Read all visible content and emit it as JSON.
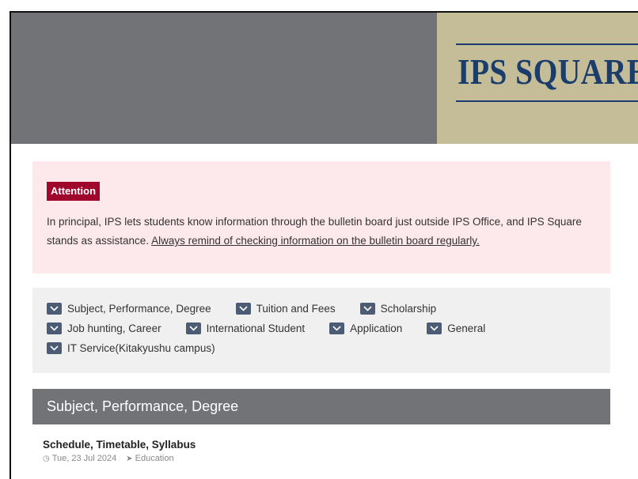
{
  "header": {
    "logo_text": "IPS SQUARE",
    "colors": {
      "banner": "#727376",
      "logo_bg": "#c5bd97",
      "logo_text": "#1a3d6b"
    }
  },
  "notice": {
    "badge": "Attention",
    "text": "In principal, IPS lets students know information through the bulletin board just outside IPS Office, and IPS Square stands as assistance. ",
    "link": "Always remind of checking information on the bulletin board regularly.",
    "colors": {
      "background": "#fde8ec",
      "badge": "#a0072d"
    }
  },
  "filters": {
    "rows": [
      [
        "Subject, Performance, Degree",
        "Tuition and Fees",
        "Scholarship"
      ],
      [
        "Job hunting, Career",
        "International Student",
        "Application",
        "General"
      ],
      [
        "IT Service(Kitakyushu campus)"
      ]
    ],
    "icon": "chevron-down-icon"
  },
  "section": {
    "title": "Subject, Performance, Degree"
  },
  "article": {
    "title": "Schedule, Timetable, Syllabus",
    "date": "Tue, 23 Jul 2024",
    "category": "Education",
    "date_icon": "clock-icon",
    "category_icon": "tag-icon"
  }
}
